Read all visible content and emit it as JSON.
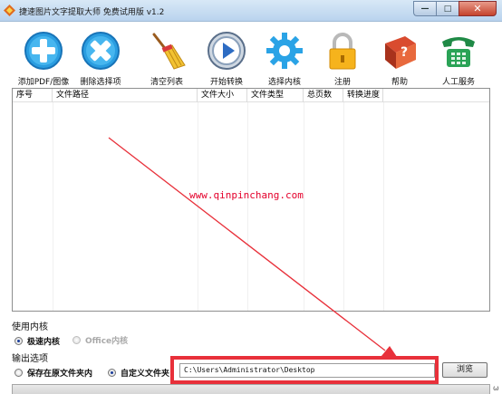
{
  "window": {
    "title": "捷速图片文字提取大师 免费试用版 v1.2",
    "minimize_glyph": "—",
    "maximize_glyph": "□",
    "close_glyph": "✕"
  },
  "toolbar": {
    "items": [
      {
        "label": "添加PDF/图像",
        "icon": "add-icon"
      },
      {
        "label": "删除选择项",
        "icon": "delete-icon"
      },
      {
        "label": "清空列表",
        "icon": "broom-icon"
      },
      {
        "label": "开始转换",
        "icon": "play-icon"
      },
      {
        "label": "选择内核",
        "icon": "gear-icon"
      },
      {
        "label": "注册",
        "icon": "lock-icon"
      },
      {
        "label": "帮助",
        "icon": "help-book-icon"
      },
      {
        "label": "人工服务",
        "icon": "phone-icon"
      }
    ]
  },
  "list": {
    "columns": [
      "序号",
      "文件路径",
      "文件大小",
      "文件类型",
      "总页数",
      "转换进度"
    ],
    "rows": []
  },
  "watermark": "www.qinpinchang.com",
  "core": {
    "section_label": "使用内核",
    "options": [
      {
        "label": "极速内核",
        "selected": true,
        "enabled": true
      },
      {
        "label": "Office内核",
        "selected": false,
        "enabled": false
      }
    ]
  },
  "output": {
    "section_label": "输出选项",
    "options": [
      {
        "label": "保存在原文件夹内",
        "selected": false
      },
      {
        "label": "自定义文件夹",
        "selected": true
      }
    ],
    "path_value": "C:\\Users\\Administrator\\Desktop",
    "browse_label": "浏览"
  },
  "status": {
    "corner_text": "ω"
  },
  "colors": {
    "annotation_red": "#e8303a",
    "watermark_red": "#e4002b"
  }
}
